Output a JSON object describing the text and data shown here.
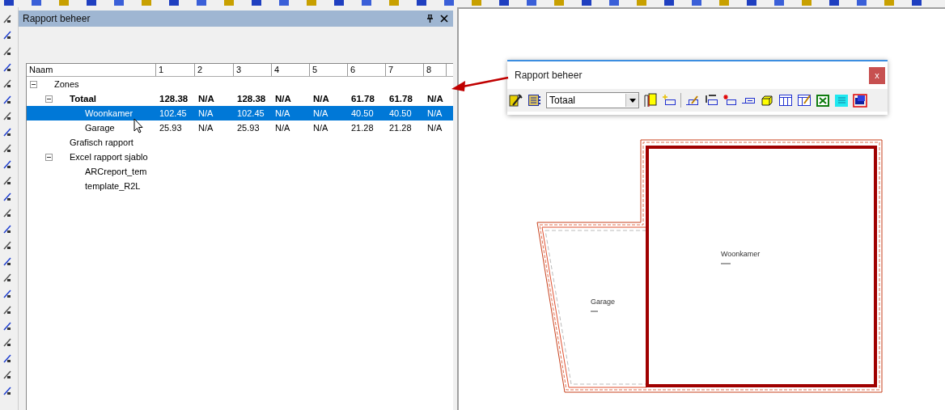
{
  "panel": {
    "title": "Rapport beheer"
  },
  "table": {
    "columns": [
      "Naam",
      "1",
      "2",
      "3",
      "4",
      "5",
      "6",
      "7",
      "8"
    ],
    "rows": [
      {
        "name": "Zones",
        "bold": false,
        "selected": false,
        "expanded": true,
        "children": [
          {
            "name": "Totaal",
            "bold": true,
            "selected": false,
            "expanded": true,
            "values": [
              "128.38",
              "N/A",
              "128.38",
              "N/A",
              "N/A",
              "61.78",
              "61.78",
              "N/A"
            ],
            "children": [
              {
                "name": "Woonkamer",
                "bold": false,
                "selected": true,
                "values": [
                  "102.45",
                  "N/A",
                  "102.45",
                  "N/A",
                  "N/A",
                  "40.50",
                  "40.50",
                  "N/A"
                ]
              },
              {
                "name": "Garage",
                "bold": false,
                "selected": false,
                "values": [
                  "25.93",
                  "N/A",
                  "25.93",
                  "N/A",
                  "N/A",
                  "21.28",
                  "21.28",
                  "N/A"
                ]
              }
            ]
          },
          {
            "name": "Grafisch rapport",
            "bold": false,
            "selected": false
          },
          {
            "name": "Excel rapport sjablo",
            "bold": false,
            "selected": false,
            "expanded": true,
            "children": [
              {
                "name": "ARCreport_tem",
                "bold": false,
                "selected": false
              },
              {
                "name": "template_R2L",
                "bold": false,
                "selected": false
              }
            ]
          }
        ]
      }
    ]
  },
  "floating_window": {
    "title": "Rapport beheer",
    "close_label": "x",
    "dropdown": {
      "value": "Totaal"
    }
  },
  "plan": {
    "rooms": [
      {
        "label": "Woonkamer",
        "selected": true
      },
      {
        "label": "Garage",
        "selected": false
      }
    ]
  }
}
